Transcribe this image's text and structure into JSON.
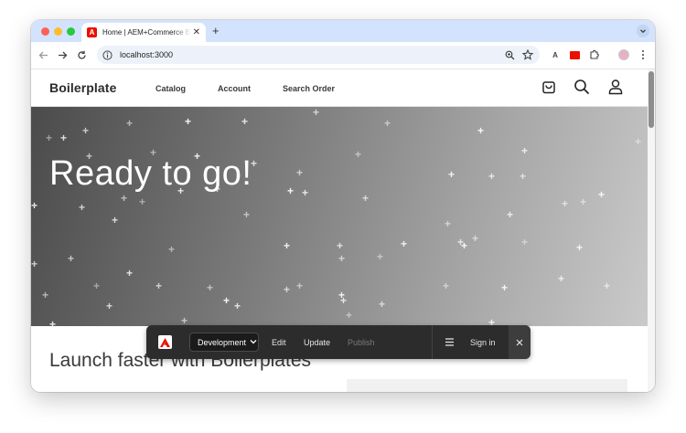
{
  "browser": {
    "tab": {
      "title": "Home | AEM+Commerce Boilerplate",
      "favicon_letter": "A"
    },
    "url": "localhost:3000",
    "extension_a_label": "A"
  },
  "site": {
    "brand": "Boilerplate",
    "nav": [
      "Catalog",
      "Account",
      "Search Order"
    ],
    "hero_title": "Ready to go!",
    "section_title": "Launch faster with Boilerplates"
  },
  "sidekick": {
    "environment": "Development",
    "actions": {
      "edit": "Edit",
      "update": "Update",
      "publish": "Publish"
    },
    "sign_in": "Sign in"
  },
  "colors": {
    "tabstrip": "#d3e3fd",
    "adobe_red": "#eb1000",
    "sidekick_bg": "#2c2c2c"
  }
}
